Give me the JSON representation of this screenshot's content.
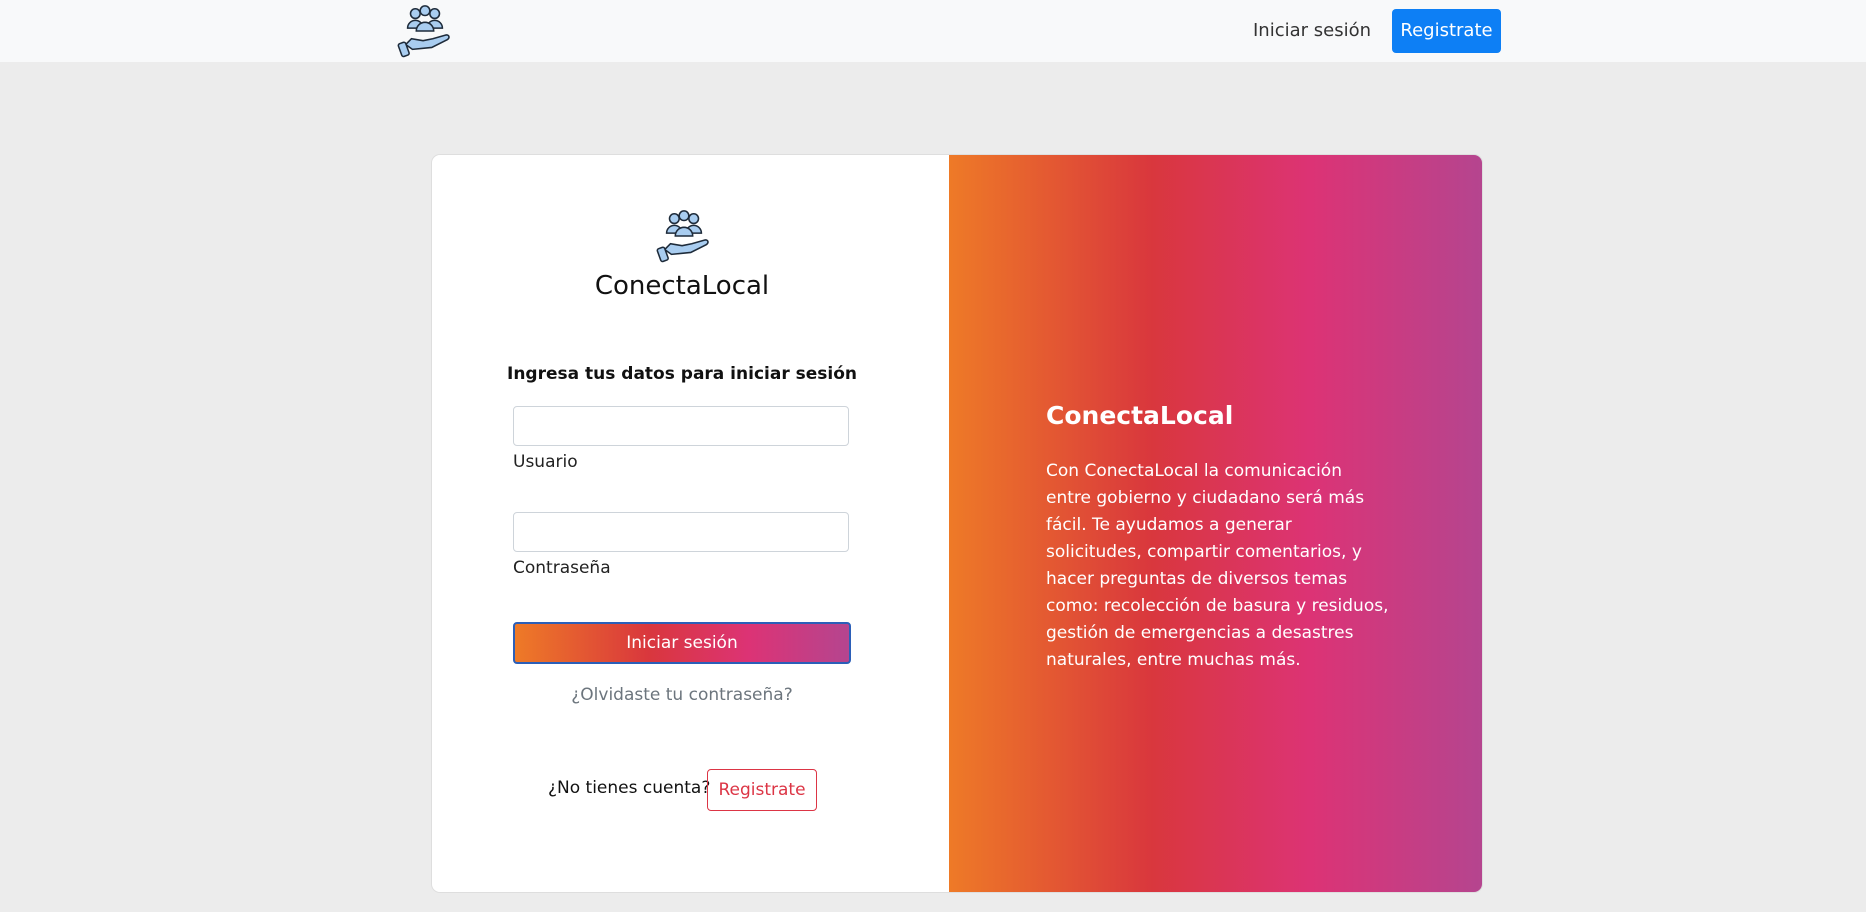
{
  "navbar": {
    "login_label": "Iniciar sesión",
    "register_label": "Registrate"
  },
  "login_card": {
    "brand": "ConectaLocal",
    "subtitle": "Ingresa tus datos para iniciar sesión",
    "username": {
      "label": "Usuario",
      "value": ""
    },
    "password": {
      "label": "Contraseña",
      "value": ""
    },
    "submit_label": "Iniciar sesión",
    "forgot_label": "¿Olvidaste tu contraseña?",
    "no_account_label": "¿No tienes cuenta?",
    "register_label": "Registrate"
  },
  "info_panel": {
    "title": "ConectaLocal",
    "description": "Con ConectaLocal la comunicación entre gobierno y ciudadano será más fácil. Te ayudamos a generar solicitudes, compartir comentarios, y hacer preguntas de diversos temas como: recolección de basura y residuos, gestión de emergencias a desastres naturales, entre muchas más."
  },
  "icons": {
    "logo": "community-hand-icon"
  },
  "colors": {
    "primary": "#0d7ff5",
    "danger": "#dc3545",
    "gradient_start": "#ee7a27",
    "gradient_mid": "#dc3375",
    "gradient_end": "#b5458f"
  }
}
